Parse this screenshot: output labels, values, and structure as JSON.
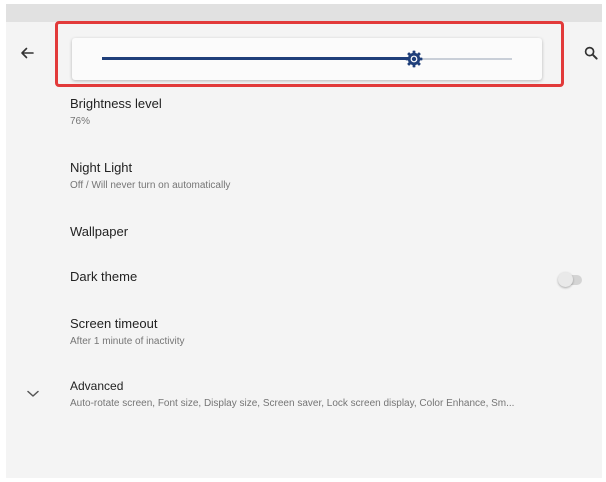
{
  "toolbar": {
    "back_icon": "arrow-left-icon",
    "search_icon": "search-icon"
  },
  "brightness_slider": {
    "value_percent": 76,
    "thumb_icon": "brightness-gear-icon",
    "fill_color": "#1f3f7a",
    "highlight_color": "#e23a3a"
  },
  "settings": {
    "brightness": {
      "title": "Brightness level",
      "subtitle": "76%"
    },
    "night_light": {
      "title": "Night Light",
      "subtitle": "Off / Will never turn on automatically"
    },
    "wallpaper": {
      "title": "Wallpaper"
    },
    "dark_theme": {
      "title": "Dark theme",
      "toggle_on": false
    },
    "screen_timeout": {
      "title": "Screen timeout",
      "subtitle": "After 1 minute of inactivity"
    },
    "advanced": {
      "title": "Advanced",
      "subtitle": "Auto-rotate screen, Font size, Display size, Screen saver, Lock screen display, Color Enhance, Sm...",
      "icon": "chevron-down-icon"
    }
  }
}
